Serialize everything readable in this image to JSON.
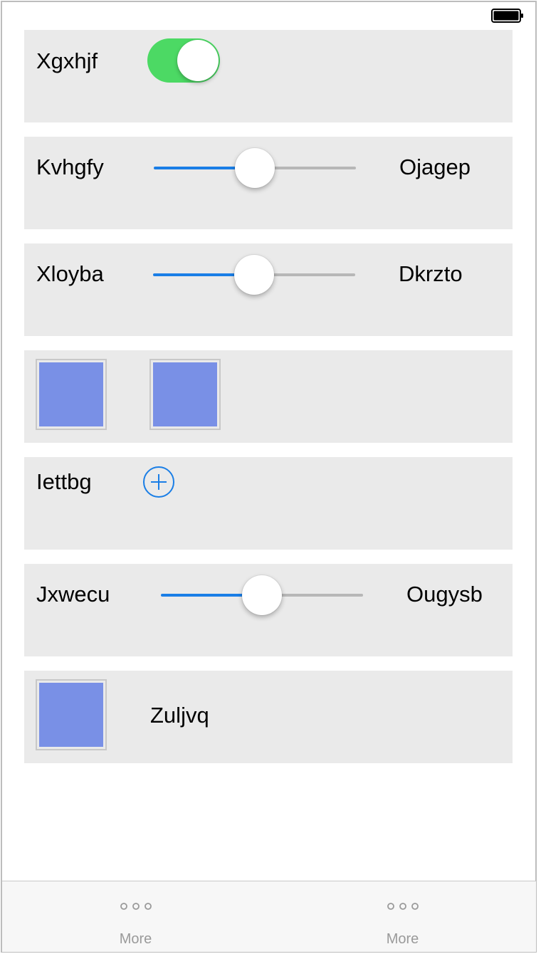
{
  "status_bar": {
    "battery_icon": "battery-full-icon"
  },
  "rows": {
    "row1": {
      "label": "Xgxhjf",
      "toggle_on": true
    },
    "row2": {
      "left_label": "Kvhgfy",
      "right_label": "Ojagep",
      "slider_value": 0.5
    },
    "row3": {
      "left_label": "Xloyba",
      "right_label": "Dkrzto",
      "slider_value": 0.5
    },
    "row4": {
      "images": [
        "image-placeholder",
        "image-placeholder"
      ]
    },
    "row5": {
      "label": "Iettbg",
      "add_icon": "plus-circle-icon"
    },
    "row6": {
      "left_label": "Jxwecu",
      "right_label": "Ougysb",
      "slider_value": 0.5
    },
    "row7": {
      "image": "image-placeholder",
      "label": "Zuljvq"
    }
  },
  "tabbar": {
    "tabs": [
      {
        "label": "More",
        "icon": "more-dots-icon"
      },
      {
        "label": "More",
        "icon": "more-dots-icon"
      }
    ]
  },
  "colors": {
    "toggle_on": "#4cd964",
    "slider_min": "#1a7ee6",
    "slider_max": "#b7b7b7",
    "image_fill": "#7990e6",
    "card_bg": "#eaeaea",
    "tint": "#1a7ee6"
  }
}
